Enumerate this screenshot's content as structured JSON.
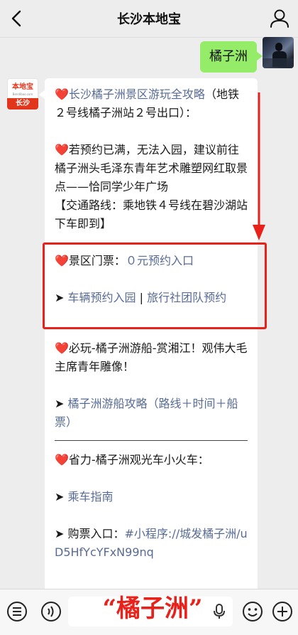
{
  "header": {
    "title": "长沙本地宝",
    "back_icon": "chevron-left-icon",
    "profile_icon": "person-icon"
  },
  "user_message": {
    "text": "橘子洲"
  },
  "bot": {
    "avatar_logo": "本地宝",
    "avatar_logo_sub": "Bendibao.com",
    "avatar_city": "长沙",
    "heart": "❤️",
    "arrow": "➤",
    "line1": "长沙橘子洲景区游玩全攻略",
    "line1_rest": "（地铁２号线橘子洲站２号出口）：",
    "line2": "若预约已满，无法入园，建议前往橘子洲头毛泽东青年艺术雕塑网红取景点——恰同学少年广场",
    "line3": "【交通路线：乘地铁４号线在碧沙湖站下车即到】",
    "ticket_label": "景区门票：",
    "ticket_link": "０元预约入口",
    "vehicle_link": "车辆预约入园",
    "divider": " | ",
    "group_link": "旅行社团队预约",
    "boat_title": "必玩-橘子洲游船-赏湘江！观伟大毛主席青年雕像！",
    "boat_link": "橘子洲游船攻略（路线＋时间＋船票）",
    "train_title": "省力-橘子洲观光车小火车：",
    "ride_link": "乘车指南",
    "buy_label": "购票入口：",
    "buy_link": "#小程序://城发橘子洲/uD5HfYcYFxN99nq"
  },
  "overlay": {
    "text": "“橘子洲”"
  },
  "bottom_bar": {
    "icons": [
      "menu-icon",
      "voice-icon",
      "mic-icon",
      "emoji-icon",
      "add-icon"
    ]
  },
  "colors": {
    "bubble_user": "#95ec69",
    "link": "#576b95",
    "annotation": "#e8221b"
  }
}
